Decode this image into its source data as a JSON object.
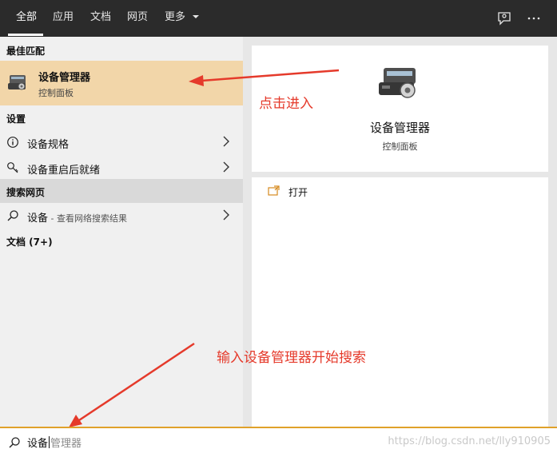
{
  "topbar": {
    "tabs": [
      "全部",
      "应用",
      "文档",
      "网页",
      "更多"
    ],
    "active_tab": "全部",
    "icons": [
      "feedback-icon",
      "more-options-icon"
    ],
    "accent_color": "#ffffff"
  },
  "left": {
    "best_match_header": "最佳匹配",
    "best_match": {
      "title": "设备管理器",
      "subtitle": "控制面板",
      "icon": "device-manager-icon",
      "highlight_color": "#f2d6a9"
    },
    "settings_header": "设置",
    "settings_items": [
      {
        "label": "设备规格",
        "icon": "info-icon"
      },
      {
        "label": "设备重启后就绪",
        "icon": "key-icon"
      }
    ],
    "web_header": "搜索网页",
    "web_item": {
      "label": "设备",
      "sublabel": " - 查看网络搜索结果",
      "icon": "search-icon"
    },
    "documents_header": "文档 (7+)"
  },
  "right": {
    "title": "设备管理器",
    "subtitle": "控制面板",
    "action_open": "打开",
    "icon": "device-manager-icon"
  },
  "annotations": {
    "click_enter": "点击进入",
    "instruction": "输入设备管理器开始搜索",
    "color": "#e53a2b"
  },
  "search": {
    "typed": "设备",
    "suggestion": "管理器",
    "icon": "search-icon"
  },
  "watermark": "https://blog.csdn.net/lly910905"
}
